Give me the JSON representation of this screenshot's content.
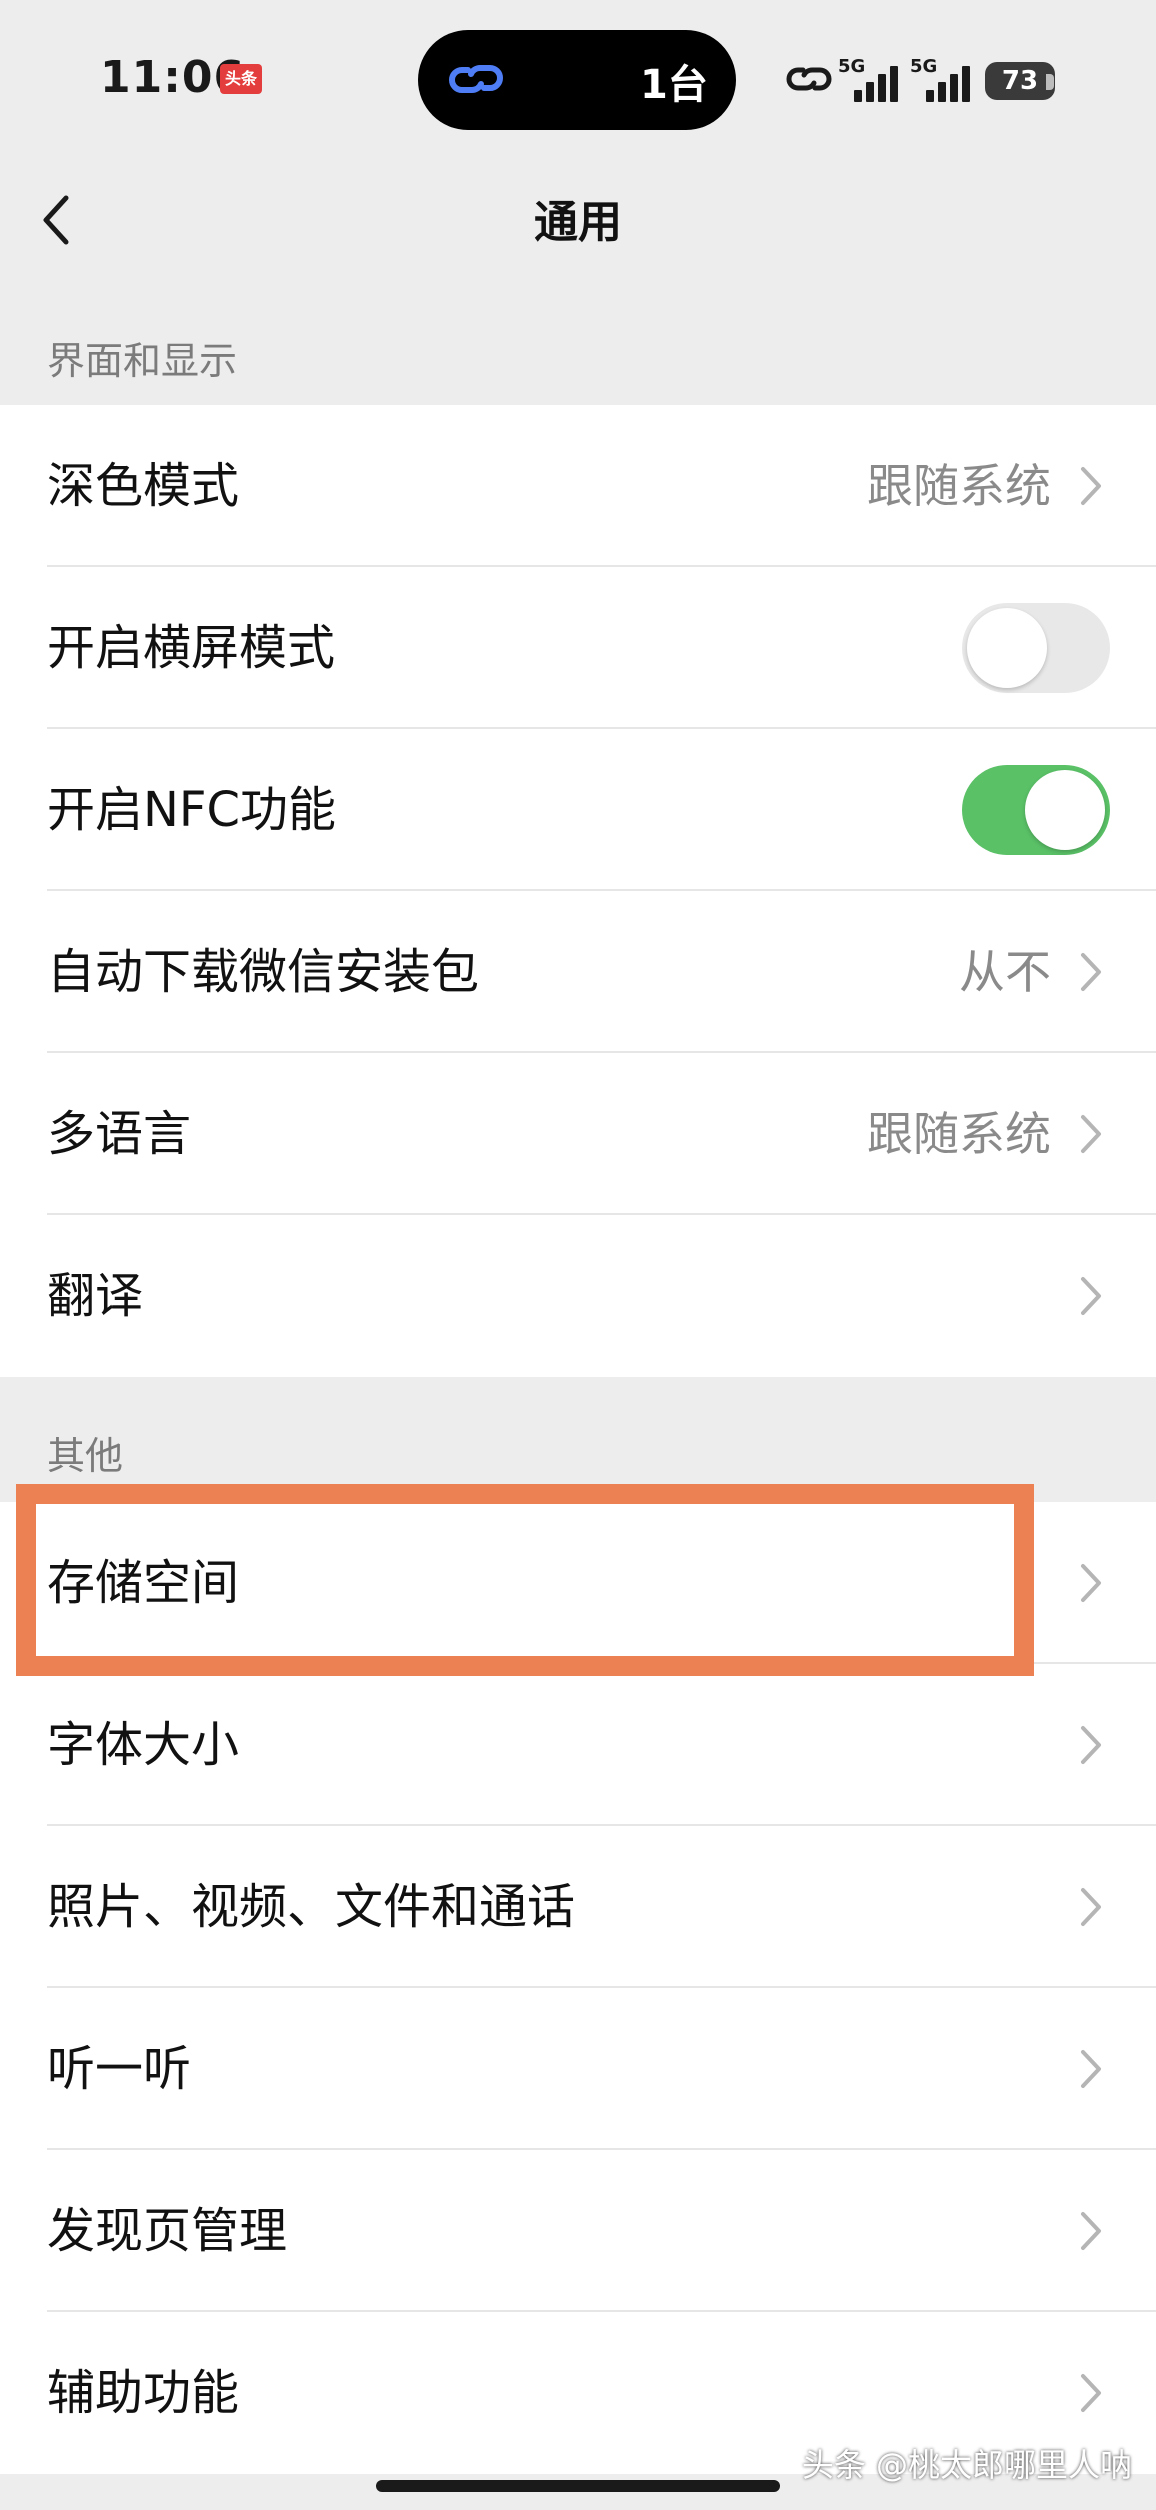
{
  "status_bar": {
    "time": "11:06",
    "app_badge": "头条",
    "island_count": "1台",
    "signal_1_label": "5G",
    "signal_2_label": "5G",
    "battery": "73"
  },
  "nav": {
    "title": "通用"
  },
  "sections": [
    {
      "header": "界面和显示",
      "items": [
        {
          "label": "深色模式",
          "value": "跟随系统",
          "kind": "chevron"
        },
        {
          "label": "开启横屏模式",
          "kind": "toggle",
          "checked": false
        },
        {
          "label": "开启NFC功能",
          "kind": "toggle",
          "checked": true
        },
        {
          "label": "自动下载微信安装包",
          "value": "从不",
          "kind": "chevron"
        },
        {
          "label": "多语言",
          "value": "跟随系统",
          "kind": "chevron"
        },
        {
          "label": "翻译",
          "kind": "chevron"
        }
      ]
    },
    {
      "header": "其他",
      "items": [
        {
          "label": "存储空间",
          "kind": "chevron",
          "highlighted": true
        },
        {
          "label": "字体大小",
          "kind": "chevron"
        },
        {
          "label": "照片、视频、文件和通话",
          "kind": "chevron"
        },
        {
          "label": "听一听",
          "kind": "chevron"
        },
        {
          "label": "发现页管理",
          "kind": "chevron"
        },
        {
          "label": "辅助功能",
          "kind": "chevron"
        }
      ]
    }
  ],
  "colors": {
    "toggle_on": "#5ac167",
    "highlight_box": "#ec8253",
    "background": "#ededed"
  },
  "watermark": "头条 @桃太郎哪里人呐"
}
